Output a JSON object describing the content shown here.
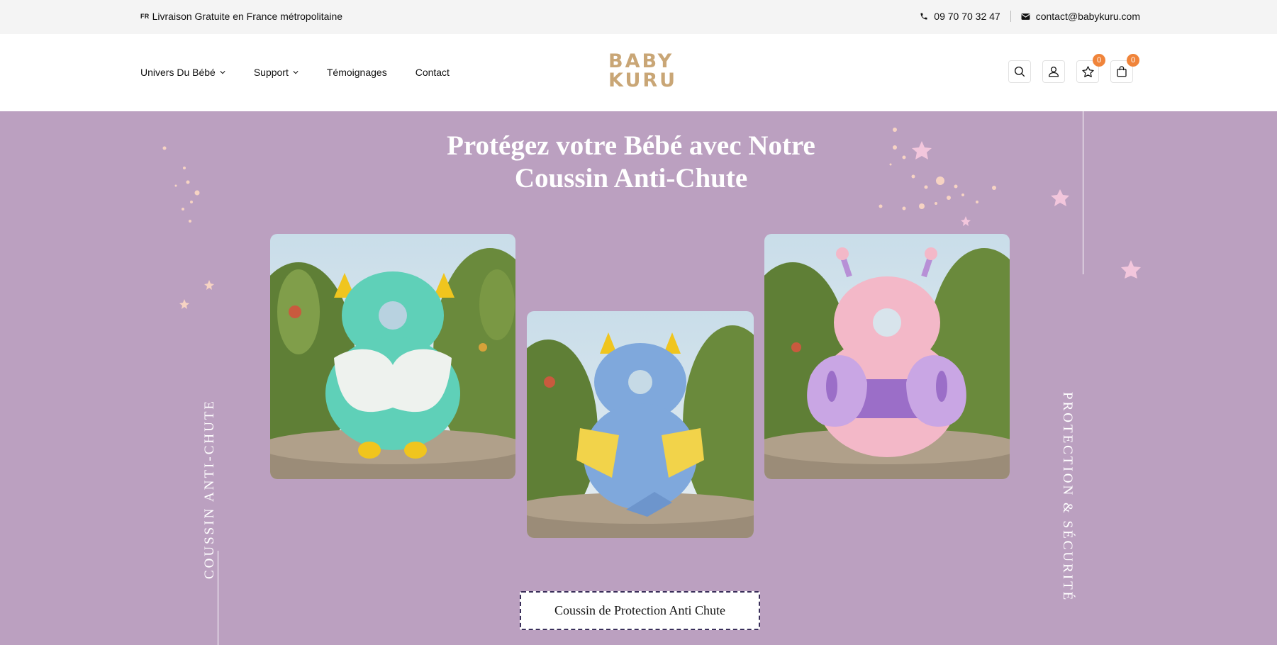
{
  "topbar": {
    "promo_flag": "FR",
    "promo_text": "Livraison Gratuite en France métropolitaine",
    "phone": "09 70 70 32 47",
    "email": "contact@babykuru.com"
  },
  "nav": {
    "items": [
      {
        "label": "Univers Du Bébé",
        "has_dropdown": true
      },
      {
        "label": "Support",
        "has_dropdown": true
      },
      {
        "label": "Témoignages",
        "has_dropdown": false
      },
      {
        "label": "Contact",
        "has_dropdown": false
      }
    ]
  },
  "logo": {
    "line1": "BABY",
    "line2": "KURU",
    "color": "#c9a676"
  },
  "actions": {
    "wishlist_count": "0",
    "cart_count": "0",
    "badge_color": "#f0843a"
  },
  "hero": {
    "title_line1": "Protégez votre Bébé avec Notre",
    "title_line2": "Coussin Anti-Chute",
    "left_vertical": "COUSSIN ANTI-CHUTE",
    "right_vertical": "PROTECTION & SÉCURITÉ",
    "cta_label": "Coussin de Protection Anti Chute",
    "background": "#bba0c0",
    "products": [
      {
        "name": "owl-cushion",
        "color": "#5fd0b8"
      },
      {
        "name": "dragon-cushion",
        "color": "#7fa8dc"
      },
      {
        "name": "butterfly-cushion",
        "color": "#f3b8c8"
      }
    ]
  }
}
